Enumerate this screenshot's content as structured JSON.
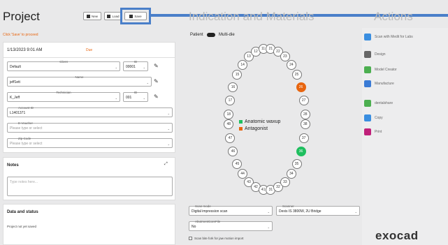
{
  "header": {
    "title": "Project",
    "new_label": "New",
    "load_label": "Load",
    "save_label": "Save",
    "indication_title": "Indication and Materials",
    "actions_title": "Actions"
  },
  "hint": "Click 'Save' to proceed",
  "project": {
    "date": "1/13/2023 9:01 AM",
    "due_label": "Due",
    "client": {
      "caption": "Client",
      "value": "Default",
      "id_caption": "ID",
      "id_value": "00001"
    },
    "name": {
      "caption": "Name",
      "value": "jeff1ett"
    },
    "technician": {
      "caption": "Technician",
      "value": "K_Jeff",
      "id_caption": "ID",
      "id_value": "001"
    },
    "account": {
      "caption": "Account ID",
      "value": "L1401371"
    },
    "evoucher": {
      "caption": "E-Voucher",
      "placeholder": "Please type or select"
    },
    "zip": {
      "caption": "Zip Code",
      "placeholder": "Please type or select"
    }
  },
  "notes": {
    "title": "Notes",
    "placeholder": "Type notes here..."
  },
  "data_status": {
    "title": "Data and status",
    "text": "Project not yet saved"
  },
  "patient": {
    "label": "Patient",
    "multidie": "Multi-die"
  },
  "legend": {
    "waxup": "Anatomic waxup",
    "antagonist": "Antagonist",
    "waxup_color": "#1fbf5f",
    "antagonist_color": "#e8650f"
  },
  "teeth_upper": [
    "18",
    "17",
    "16",
    "15",
    "14",
    "13",
    "12",
    "11",
    "21",
    "22",
    "23",
    "24",
    "25",
    "26",
    "27",
    "28"
  ],
  "teeth_lower": [
    "48",
    "47",
    "46",
    "45",
    "44",
    "43",
    "42",
    "41",
    "31",
    "32",
    "33",
    "34",
    "35",
    "36",
    "37",
    "38"
  ],
  "scan": {
    "mode_caption": "Scan mode",
    "mode_value": "Digital impression scan",
    "scanner_caption": "Scanner",
    "scanner_value": "Dexis IS 3800W, 2U Bridge",
    "abutment_caption": "AbutmentCoreFile",
    "abutment_value": "No",
    "bite_label": "Scan bite fork for jaw motion import"
  },
  "actions": [
    {
      "label": "Scan with Medit for Labs",
      "color": "#3a8ee0"
    },
    {
      "label": "Design",
      "color": "#666"
    },
    {
      "label": "Model Creator",
      "color": "#4caf50"
    },
    {
      "label": "Manufacture",
      "color": "#3a7bd5"
    },
    {
      "label": "dentalshare",
      "color": "#4caf50"
    },
    {
      "label": "Copy",
      "color": "#3a8ee0"
    },
    {
      "label": "Print",
      "color": "#c0207a"
    }
  ],
  "brand": "exocad"
}
